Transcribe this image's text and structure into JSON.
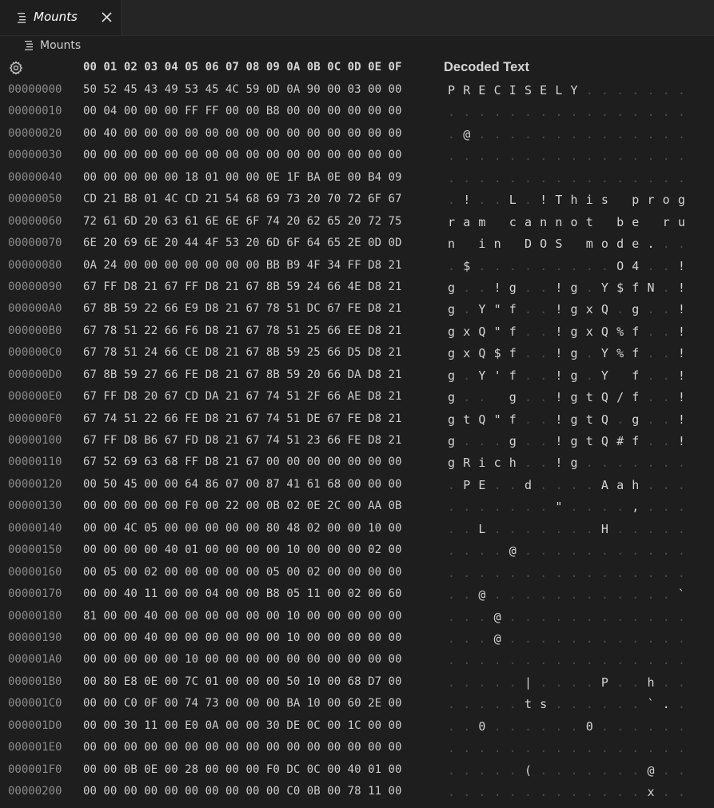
{
  "tab": {
    "label": "Mounts",
    "icon": "file-lines-icon",
    "close_icon": "close-icon"
  },
  "breadcrumb": {
    "label": "Mounts",
    "icon": "file-lines-icon"
  },
  "header": {
    "settings_icon": "gear-icon",
    "columns": "00 01 02 03 04 05 06 07 08 09 0A 0B 0C 0D 0E 0F",
    "decoded_label": "Decoded Text"
  },
  "colors": {
    "background": "#1e1e1e",
    "address": "#8b8b8b",
    "hex": "#cccccc",
    "nonprintable_dot": "#4a4a4a"
  },
  "rows": [
    {
      "addr": "00000000",
      "hex": "50 52 45 43 49 53 45 4C 59 0D 0A 90 00 03 00 00",
      "text": "PRECISELY......."
    },
    {
      "addr": "00000010",
      "hex": "00 04 00 00 00 FF FF 00 00 B8 00 00 00 00 00 00",
      "text": "................"
    },
    {
      "addr": "00000020",
      "hex": "00 40 00 00 00 00 00 00 00 00 00 00 00 00 00 00",
      "text": ".@.............."
    },
    {
      "addr": "00000030",
      "hex": "00 00 00 00 00 00 00 00 00 00 00 00 00 00 00 00",
      "text": "................"
    },
    {
      "addr": "00000040",
      "hex": "00 00 00 00 00 18 01 00 00 0E 1F BA 0E 00 B4 09",
      "text": "................"
    },
    {
      "addr": "00000050",
      "hex": "CD 21 B8 01 4C CD 21 54 68 69 73 20 70 72 6F 67",
      "text": ".!..L.!This prog"
    },
    {
      "addr": "00000060",
      "hex": "72 61 6D 20 63 61 6E 6E 6F 74 20 62 65 20 72 75",
      "text": "ram cannot be ru"
    },
    {
      "addr": "00000070",
      "hex": "6E 20 69 6E 20 44 4F 53 20 6D 6F 64 65 2E 0D 0D",
      "text": "n in DOS mode..."
    },
    {
      "addr": "00000080",
      "hex": "0A 24 00 00 00 00 00 00 00 BB B9 4F 34 FF D8 21",
      "text": ".$.........O4..!"
    },
    {
      "addr": "00000090",
      "hex": "67 FF D8 21 67 FF D8 21 67 8B 59 24 66 4E D8 21",
      "text": "g..!g..!g.Y$fN.!"
    },
    {
      "addr": "000000A0",
      "hex": "67 8B 59 22 66 E9 D8 21 67 78 51 DC 67 FE D8 21",
      "text": "g.Y\"f..!gxQ.g..!"
    },
    {
      "addr": "000000B0",
      "hex": "67 78 51 22 66 F6 D8 21 67 78 51 25 66 EE D8 21",
      "text": "gxQ\"f..!gxQ%f..!"
    },
    {
      "addr": "000000C0",
      "hex": "67 78 51 24 66 CE D8 21 67 8B 59 25 66 D5 D8 21",
      "text": "gxQ$f..!g.Y%f..!"
    },
    {
      "addr": "000000D0",
      "hex": "67 8B 59 27 66 FE D8 21 67 8B 59 20 66 DA D8 21",
      "text": "g.Y'f..!g.Y f..!"
    },
    {
      "addr": "000000E0",
      "hex": "67 FF D8 20 67 CD DA 21 67 74 51 2F 66 AE D8 21",
      "text": "g.. g..!gtQ/f..!"
    },
    {
      "addr": "000000F0",
      "hex": "67 74 51 22 66 FE D8 21 67 74 51 DE 67 FE D8 21",
      "text": "gtQ\"f..!gtQ.g..!"
    },
    {
      "addr": "00000100",
      "hex": "67 FF D8 B6 67 FD D8 21 67 74 51 23 66 FE D8 21",
      "text": "g...g..!gtQ#f..!"
    },
    {
      "addr": "00000110",
      "hex": "67 52 69 63 68 FF D8 21 67 00 00 00 00 00 00 00",
      "text": "gRich..!g......."
    },
    {
      "addr": "00000120",
      "hex": "00 50 45 00 00 64 86 07 00 87 41 61 68 00 00 00",
      "text": ".PE..d....Aah..."
    },
    {
      "addr": "00000130",
      "hex": "00 00 00 00 00 F0 00 22 00 0B 02 0E 2C 00 AA 0B",
      "text": ".......\"....,..."
    },
    {
      "addr": "00000140",
      "hex": "00 00 4C 05 00 00 00 00 00 80 48 02 00 00 10 00",
      "text": "..L.......H....."
    },
    {
      "addr": "00000150",
      "hex": "00 00 00 00 40 01 00 00 00 00 10 00 00 00 02 00",
      "text": "....@..........."
    },
    {
      "addr": "00000160",
      "hex": "00 05 00 02 00 00 00 00 00 05 00 02 00 00 00 00",
      "text": "................"
    },
    {
      "addr": "00000170",
      "hex": "00 00 40 11 00 00 04 00 00 B8 05 11 00 02 00 60",
      "text": "..@............`"
    },
    {
      "addr": "00000180",
      "hex": "81 00 00 40 00 00 00 00 00 00 10 00 00 00 00 00",
      "text": "...@............"
    },
    {
      "addr": "00000190",
      "hex": "00 00 00 40 00 00 00 00 00 00 10 00 00 00 00 00",
      "text": "...@............"
    },
    {
      "addr": "000001A0",
      "hex": "00 00 00 00 00 10 00 00 00 00 00 00 00 00 00 00",
      "text": "................"
    },
    {
      "addr": "000001B0",
      "hex": "00 80 E8 0E 00 7C 01 00 00 00 50 10 00 68 D7 00",
      "text": ".....|....P..h.."
    },
    {
      "addr": "000001C0",
      "hex": "00 00 C0 0F 00 74 73 00 00 00 BA 10 00 60 2E 00",
      "text": ".....ts......`.."
    },
    {
      "addr": "000001D0",
      "hex": "00 00 30 11 00 E0 0A 00 00 30 DE 0C 00 1C 00 00",
      "text": "..0......0......"
    },
    {
      "addr": "000001E0",
      "hex": "00 00 00 00 00 00 00 00 00 00 00 00 00 00 00 00",
      "text": "................"
    },
    {
      "addr": "000001F0",
      "hex": "00 00 0B 0E 00 28 00 00 00 F0 DC 0C 00 40 01 00",
      "text": ".....(.......@.."
    },
    {
      "addr": "00000200",
      "hex": "00 00 00 00 00 00 00 00 00 00 C0 0B 00 78 11 00",
      "text": ".............x.."
    }
  ]
}
